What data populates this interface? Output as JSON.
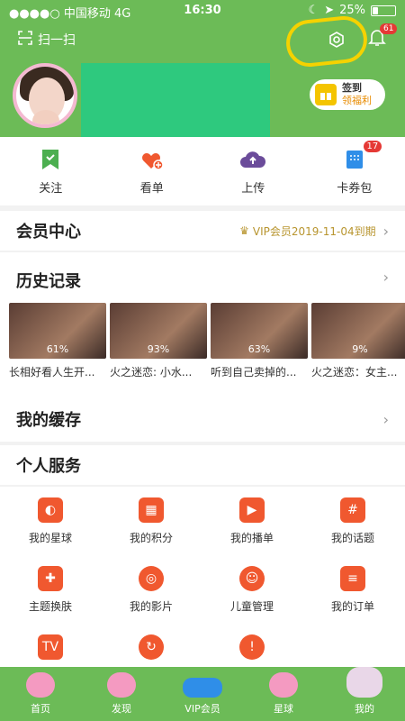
{
  "status": {
    "carrier": "中国移动",
    "network": "4G",
    "time": "16:30",
    "battery": "25%",
    "battery_level": 0.25
  },
  "header": {
    "scan_label": "扫一扫",
    "notification_count": "61",
    "signin_title": "签到",
    "signin_sub": "领福利"
  },
  "quick": {
    "items": [
      {
        "label": "关注",
        "icon": "bookmark-icon",
        "badge": ""
      },
      {
        "label": "看单",
        "icon": "heart-plus-icon",
        "badge": ""
      },
      {
        "label": "上传",
        "icon": "upload-cloud-icon",
        "badge": ""
      },
      {
        "label": "卡券包",
        "icon": "coupon-icon",
        "badge": "17"
      }
    ]
  },
  "vip": {
    "title": "会员中心",
    "info": "VIP会员2019-11-04到期"
  },
  "history": {
    "title": "历史记录",
    "items": [
      {
        "progress": "61%",
        "caption": "长相好看人生开..."
      },
      {
        "progress": "93%",
        "caption": "火之迷恋: 小水..."
      },
      {
        "progress": "63%",
        "caption": "听到自己卖掉的..."
      },
      {
        "progress": "9%",
        "caption": "火之迷恋：女主..."
      }
    ]
  },
  "cache": {
    "title": "我的缓存"
  },
  "services": {
    "title": "个人服务",
    "items": [
      {
        "label": "我的星球",
        "icon": "planet-icon"
      },
      {
        "label": "我的积分",
        "icon": "basket-icon"
      },
      {
        "label": "我的播单",
        "icon": "playlist-icon"
      },
      {
        "label": "我的话题",
        "icon": "hashtag-icon"
      },
      {
        "label": "主题换肤",
        "icon": "shirt-icon"
      },
      {
        "label": "我的影片",
        "icon": "film-reel-icon"
      },
      {
        "label": "儿童管理",
        "icon": "child-icon"
      },
      {
        "label": "我的订单",
        "icon": "order-icon"
      },
      {
        "label": "",
        "icon": "tv-icon"
      },
      {
        "label": "",
        "icon": "refresh-icon"
      },
      {
        "label": "",
        "icon": "alert-icon"
      }
    ]
  },
  "tabbar": {
    "items": [
      {
        "label": "首页"
      },
      {
        "label": "发现"
      },
      {
        "label": "VIP会员"
      },
      {
        "label": "星球"
      },
      {
        "label": "我的"
      }
    ]
  },
  "colors": {
    "brand_green": "#6cbb57",
    "accent_orange": "#f0582f",
    "highlight_yellow": "#f5d200"
  }
}
